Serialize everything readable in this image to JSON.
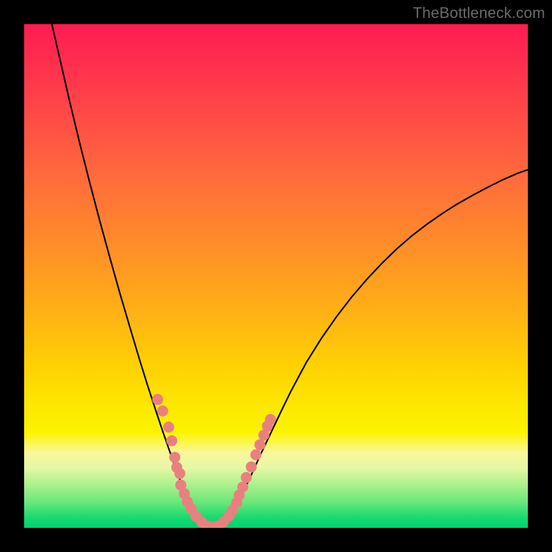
{
  "watermark": "TheBottleneck.com",
  "colors": {
    "curve": "#000000",
    "dot": "#e98080",
    "frame": "#000000"
  },
  "chart_data": {
    "type": "line",
    "title": "",
    "xlabel": "",
    "ylabel": "",
    "xlim": [
      0,
      100
    ],
    "ylim": [
      0,
      100
    ],
    "curve_points": [
      {
        "x": 5.5,
        "y": 100.0
      },
      {
        "x": 7.0,
        "y": 93.5
      },
      {
        "x": 9.0,
        "y": 84.8
      },
      {
        "x": 11.0,
        "y": 76.5
      },
      {
        "x": 13.0,
        "y": 68.6
      },
      {
        "x": 15.0,
        "y": 61.0
      },
      {
        "x": 17.0,
        "y": 53.7
      },
      {
        "x": 19.0,
        "y": 46.6
      },
      {
        "x": 21.0,
        "y": 39.8
      },
      {
        "x": 23.0,
        "y": 33.1
      },
      {
        "x": 24.5,
        "y": 28.3
      },
      {
        "x": 26.0,
        "y": 23.7
      },
      {
        "x": 27.5,
        "y": 19.2
      },
      {
        "x": 29.0,
        "y": 14.9
      },
      {
        "x": 30.0,
        "y": 12.0
      },
      {
        "x": 31.0,
        "y": 9.4
      },
      {
        "x": 32.0,
        "y": 7.0
      },
      {
        "x": 33.0,
        "y": 4.8
      },
      {
        "x": 34.0,
        "y": 3.0
      },
      {
        "x": 35.0,
        "y": 1.6
      },
      {
        "x": 36.0,
        "y": 0.8
      },
      {
        "x": 37.0,
        "y": 0.4
      },
      {
        "x": 38.0,
        "y": 0.4
      },
      {
        "x": 39.0,
        "y": 0.8
      },
      {
        "x": 40.0,
        "y": 1.6
      },
      {
        "x": 41.0,
        "y": 2.8
      },
      {
        "x": 42.0,
        "y": 4.4
      },
      {
        "x": 43.0,
        "y": 6.2
      },
      {
        "x": 44.0,
        "y": 8.2
      },
      {
        "x": 45.0,
        "y": 10.3
      },
      {
        "x": 47.0,
        "y": 14.7
      },
      {
        "x": 49.0,
        "y": 18.9
      },
      {
        "x": 51.0,
        "y": 23.1
      },
      {
        "x": 53.0,
        "y": 27.2
      },
      {
        "x": 56.0,
        "y": 32.8
      },
      {
        "x": 59.0,
        "y": 37.6
      },
      {
        "x": 62.0,
        "y": 41.9
      },
      {
        "x": 65.0,
        "y": 45.8
      },
      {
        "x": 68.0,
        "y": 49.3
      },
      {
        "x": 71.0,
        "y": 52.5
      },
      {
        "x": 74.0,
        "y": 55.4
      },
      {
        "x": 77.0,
        "y": 58.0
      },
      {
        "x": 80.0,
        "y": 60.3
      },
      {
        "x": 83.0,
        "y": 62.4
      },
      {
        "x": 86.0,
        "y": 64.3
      },
      {
        "x": 89.0,
        "y": 66.0
      },
      {
        "x": 92.0,
        "y": 67.6
      },
      {
        "x": 95.0,
        "y": 69.1
      },
      {
        "x": 98.0,
        "y": 70.4
      },
      {
        "x": 100.0,
        "y": 71.1
      }
    ],
    "scatter_points": [
      {
        "x": 26.5,
        "y": 25.5
      },
      {
        "x": 27.5,
        "y": 23.2
      },
      {
        "x": 28.7,
        "y": 20.0
      },
      {
        "x": 29.3,
        "y": 17.3
      },
      {
        "x": 29.9,
        "y": 14.0
      },
      {
        "x": 30.3,
        "y": 12.0
      },
      {
        "x": 30.9,
        "y": 10.8
      },
      {
        "x": 31.1,
        "y": 8.5
      },
      {
        "x": 31.8,
        "y": 6.8
      },
      {
        "x": 32.4,
        "y": 5.2
      },
      {
        "x": 33.2,
        "y": 3.8
      },
      {
        "x": 34.1,
        "y": 2.3
      },
      {
        "x": 35.2,
        "y": 1.2
      },
      {
        "x": 36.2,
        "y": 0.4
      },
      {
        "x": 37.0,
        "y": 0.2
      },
      {
        "x": 37.8,
        "y": 0.2
      },
      {
        "x": 38.6,
        "y": 0.4
      },
      {
        "x": 39.6,
        "y": 1.2
      },
      {
        "x": 40.7,
        "y": 2.4
      },
      {
        "x": 41.4,
        "y": 3.6
      },
      {
        "x": 42.2,
        "y": 5.0
      },
      {
        "x": 42.7,
        "y": 6.5
      },
      {
        "x": 43.4,
        "y": 8.1
      },
      {
        "x": 44.1,
        "y": 10.0
      },
      {
        "x": 45.1,
        "y": 12.1
      },
      {
        "x": 46.0,
        "y": 14.5
      },
      {
        "x": 46.8,
        "y": 16.5
      },
      {
        "x": 47.6,
        "y": 18.4
      },
      {
        "x": 48.3,
        "y": 20.2
      },
      {
        "x": 48.9,
        "y": 21.5
      }
    ]
  }
}
